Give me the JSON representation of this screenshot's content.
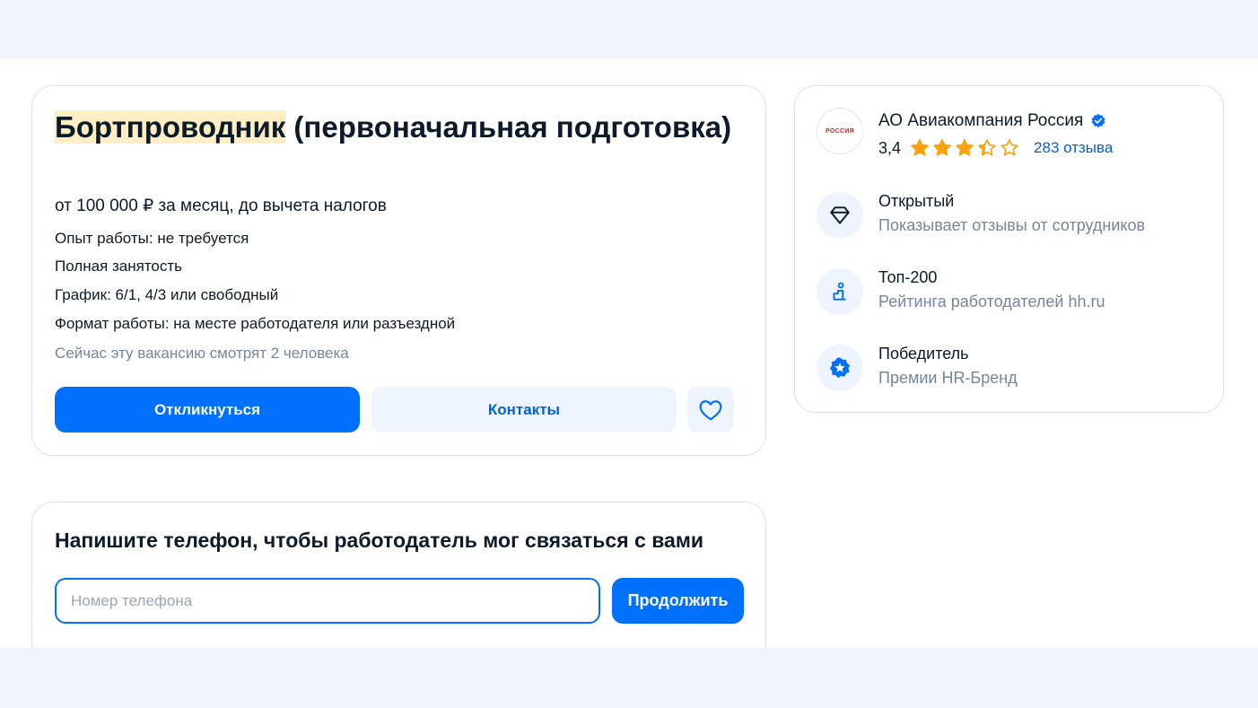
{
  "vacancy": {
    "title_highlight": "Бортпроводник",
    "title_rest": " (первоначальная подготовка)",
    "salary": "от 100 000 ₽ за месяц, до вычета налогов",
    "experience": "Опыт работы: не требуется",
    "employment": "Полная занятость",
    "schedule": "График: 6/1, 4/3 или свободный",
    "work_format": "Формат работы: на месте работодателя или разъездной",
    "viewers": "Сейчас эту вакансию смотрят 2 человека",
    "respond_label": "Откликнуться",
    "contacts_label": "Контакты"
  },
  "phone": {
    "title": "Напишите телефон, чтобы работодатель мог связаться с вами",
    "placeholder": "Номер телефона",
    "value": "",
    "continue_label": "Продолжить"
  },
  "company": {
    "logo_text": "РОССИЯ",
    "name": "АО Авиакомпания Россия",
    "rating": "3,4",
    "rating_fraction": 0.68,
    "reviews": "283 отзыва",
    "features": [
      {
        "title": "Открытый",
        "subtitle": "Показывает отзывы от сотрудников",
        "icon": "diamond-icon"
      },
      {
        "title": "Топ-200",
        "subtitle": "Рейтинга работодателей hh.ru",
        "icon": "podium-icon"
      },
      {
        "title": "Победитель",
        "subtitle": "Премии HR-Бренд",
        "icon": "star-badge-icon"
      }
    ]
  },
  "colors": {
    "accent": "#0070ff",
    "accent_text": "#0061d9",
    "star": "#ffa10a",
    "highlight": "#fdefc3",
    "page_bg": "#eef3fc"
  }
}
